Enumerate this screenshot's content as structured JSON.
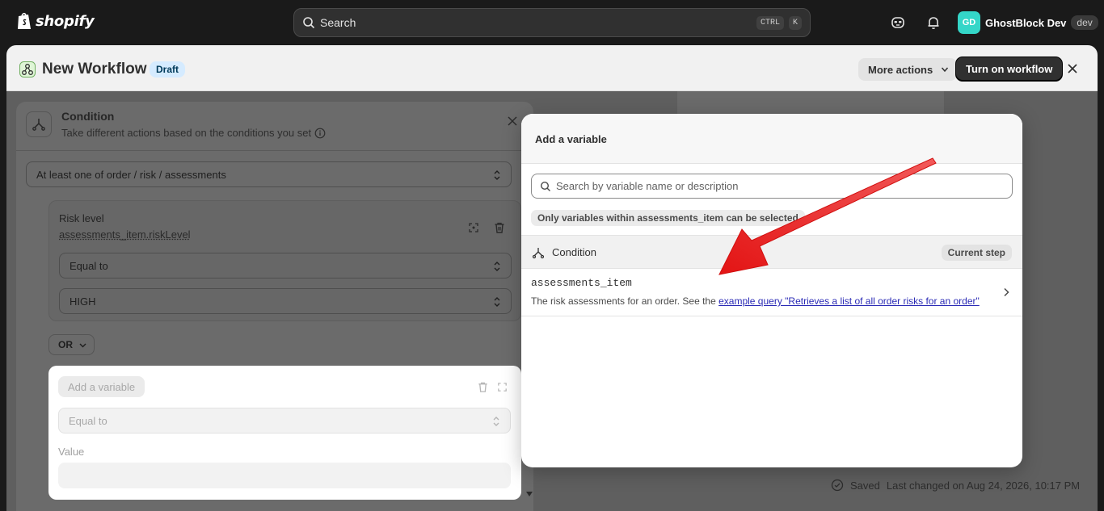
{
  "topbar": {
    "logo_text": "shopify",
    "search_placeholder": "Search",
    "shortcut_keys": [
      "CTRL",
      "K"
    ],
    "user_initials": "GD",
    "user_name": "GhostBlock Dev",
    "user_badge": "dev"
  },
  "workflow": {
    "title": "New Workflow",
    "status": "Draft",
    "more_actions": "More actions",
    "turn_on": "Turn on workflow",
    "saved_label": "Saved",
    "last_changed": "Last changed on Aug 24, 2026, 10:17 PM"
  },
  "condition_panel": {
    "title": "Condition",
    "subtitle": "Take different actions based on the conditions you set",
    "scope_select": "At least one of order / risk / assessments",
    "rule1": {
      "label": "Risk level",
      "variable": "assessments_item.riskLevel",
      "operator": "Equal to",
      "value": "HIGH"
    },
    "or_label": "OR",
    "rule2": {
      "add_variable": "Add a variable",
      "operator": "Equal to",
      "value_label": "Value"
    }
  },
  "modal": {
    "title": "Add a variable",
    "search_placeholder": "Search by variable name or description",
    "hint": "Only variables within assessments_item can be selected",
    "section_label": "Condition",
    "section_badge": "Current step",
    "item": {
      "name": "assessments_item",
      "desc_prefix": "The risk assessments for an order. See the ",
      "desc_link": "example query \"Retrieves a list of all order risks for an order\""
    }
  },
  "colors": {
    "annotation_arrow": "#ee1c1c",
    "primary_button": "#303030",
    "avatar": "#34d6c8"
  }
}
